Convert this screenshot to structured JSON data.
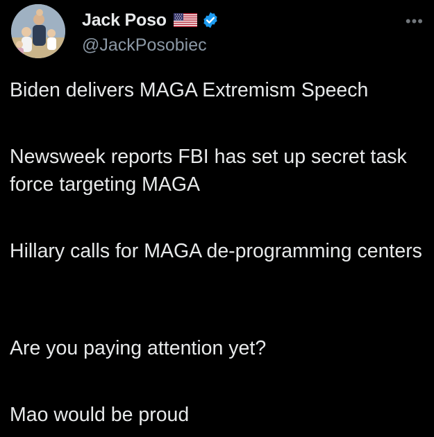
{
  "author": {
    "display_name": "Jack Poso",
    "handle": "@JackPosobiec",
    "flag_icon": "us-flag-icon",
    "verified_icon": "verified-badge-icon",
    "verified_color": "#1d9bf0"
  },
  "more_label": "•••",
  "tweet": {
    "paragraphs": [
      "Biden delivers MAGA Extremism Speech",
      "Newsweek reports FBI has set up secret task force targeting MAGA",
      "Hillary calls for MAGA de-programming centers",
      "Are you paying attention yet?",
      "Mao would be proud"
    ]
  },
  "colors": {
    "background": "#000000",
    "text": "#e7e9ea",
    "secondary_text": "#8b98a5"
  }
}
